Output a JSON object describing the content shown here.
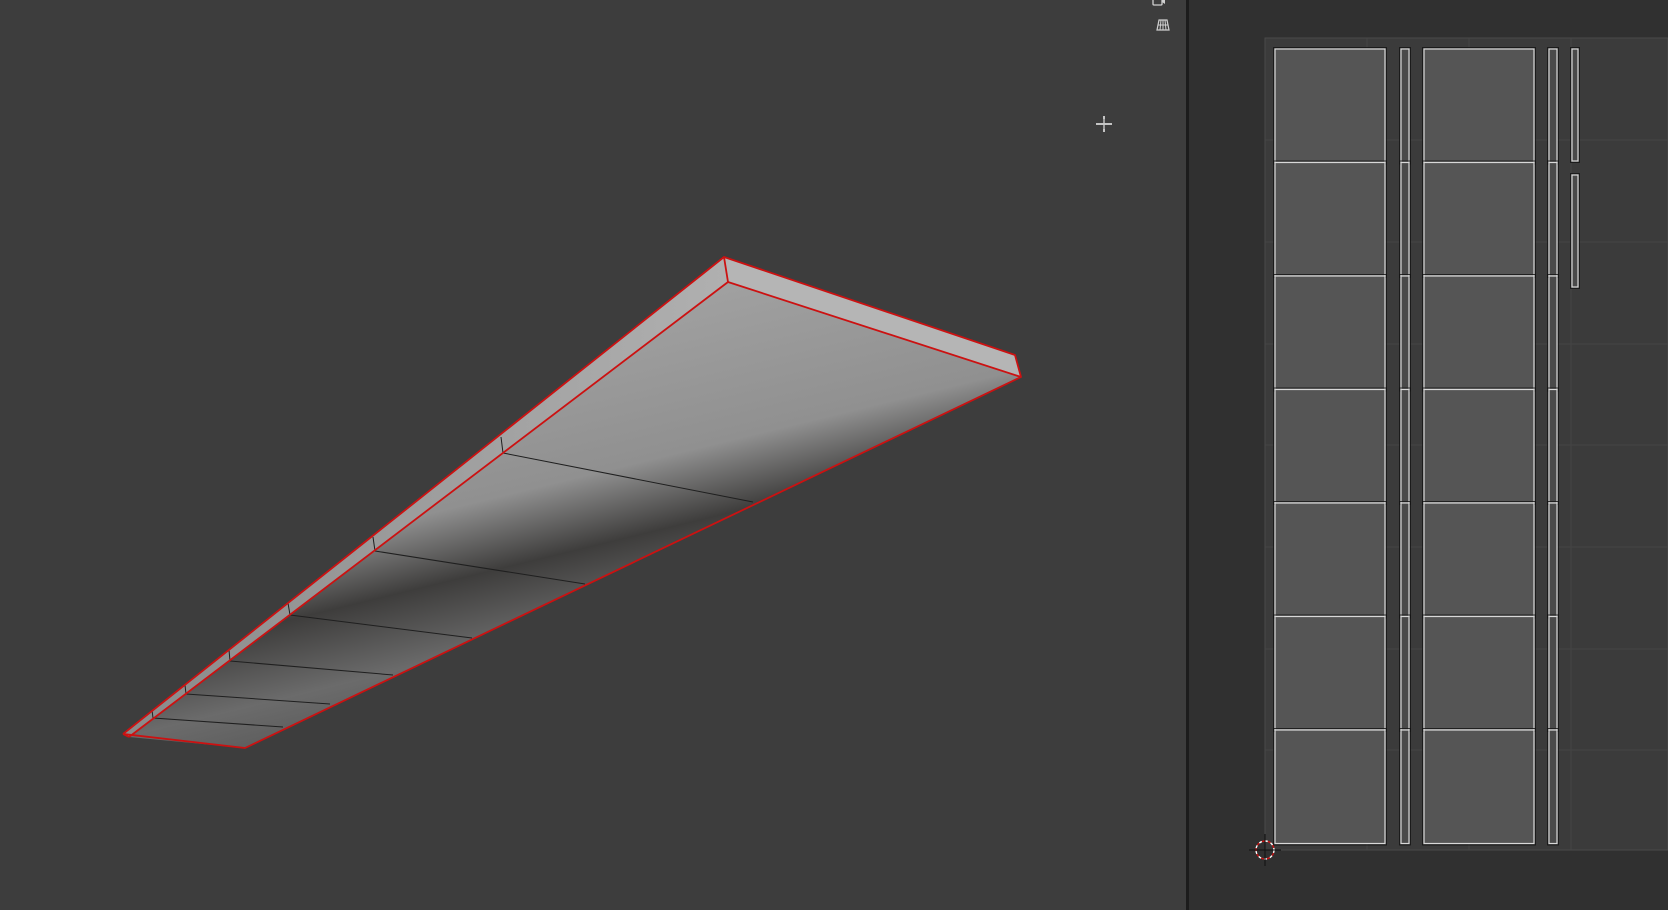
{
  "viewport": {
    "editor": "3d-viewport",
    "background": "#3d3d3d",
    "overlay_icons": [
      "camera-icon",
      "perspective-grid-icon"
    ],
    "cursor": "crosshair-cursor"
  },
  "mesh": {
    "selection_color": "#cc1111",
    "edge_color": "#1a1a1a",
    "surface_light": "#a2a2a2",
    "surface_dark": "#3b3a39"
  },
  "uv_editor": {
    "editor": "uv-editor",
    "background": "#303030",
    "image_background": "#3b3b3b",
    "uv_face_fill": "#555555",
    "uv_edge_color": "#d8d8d8",
    "rows": 7,
    "columns": [
      "large-island",
      "thin-strip",
      "large-island",
      "thin-strip",
      "small-strip"
    ],
    "cursor_2d": "uv-2d-cursor"
  }
}
